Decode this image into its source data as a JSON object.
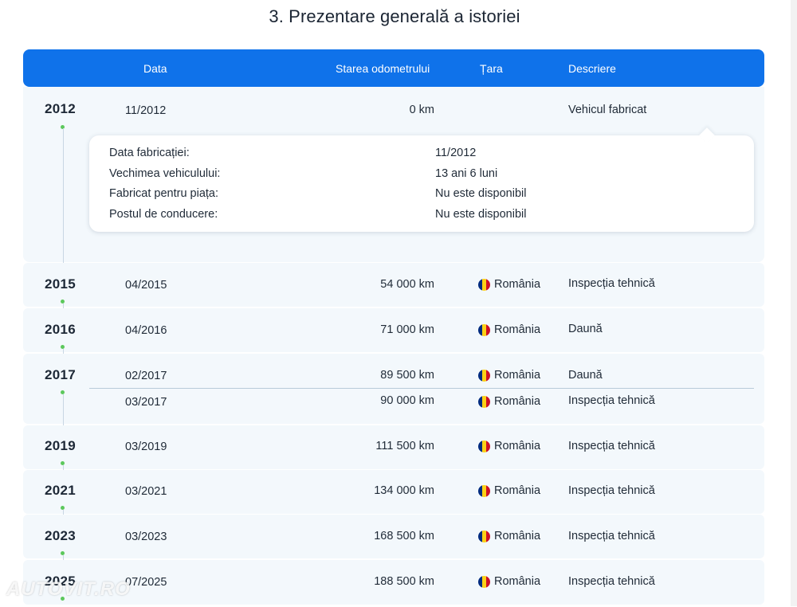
{
  "page": {
    "title": "3. Prezentare generală a istoriei"
  },
  "table": {
    "headers": {
      "date": "Data",
      "odometer": "Starea odometrului",
      "country": "Țara",
      "description": "Descriere"
    },
    "groups": [
      {
        "year": "2012",
        "rows": [
          {
            "date": "11/2012",
            "odometer": "0 km",
            "country": "",
            "description": "Vehicul fabricat"
          }
        ],
        "details": [
          {
            "label": "Data fabricației:",
            "value": "11/2012"
          },
          {
            "label": "Vechimea vehiculului:",
            "value": "13 ani 6 luni"
          },
          {
            "label": "Fabricat pentru piața:",
            "value": "Nu este disponibil"
          },
          {
            "label": "Postul de conducere:",
            "value": "Nu este disponibil"
          }
        ]
      },
      {
        "year": "2015",
        "rows": [
          {
            "date": "04/2015",
            "odometer": "54 000 km",
            "country": "România",
            "description": "Inspecția tehnică"
          }
        ]
      },
      {
        "year": "2016",
        "rows": [
          {
            "date": "04/2016",
            "odometer": "71 000 km",
            "country": "România",
            "description": "Daună"
          }
        ]
      },
      {
        "year": "2017",
        "rows": [
          {
            "date": "02/2017",
            "odometer": "89 500 km",
            "country": "România",
            "description": "Daună"
          },
          {
            "date": "03/2017",
            "odometer": "90 000 km",
            "country": "România",
            "description": "Inspecția tehnică"
          }
        ]
      },
      {
        "year": "2019",
        "rows": [
          {
            "date": "03/2019",
            "odometer": "111 500 km",
            "country": "România",
            "description": "Inspecția tehnică"
          }
        ]
      },
      {
        "year": "2021",
        "rows": [
          {
            "date": "03/2021",
            "odometer": "134 000 km",
            "country": "România",
            "description": "Inspecția tehnică"
          }
        ]
      },
      {
        "year": "2023",
        "rows": [
          {
            "date": "03/2023",
            "odometer": "168 500 km",
            "country": "România",
            "description": "Inspecția tehnică"
          }
        ]
      },
      {
        "year": "2025",
        "rows": [
          {
            "date": "07/2025",
            "odometer": "188 500 km",
            "country": "România",
            "description": "Inspecția tehnică"
          }
        ]
      }
    ]
  },
  "watermark": "AUTOVIT.RO",
  "colors": {
    "header": "#0f72ea",
    "row_bg": "#f3f8fc",
    "dot": "#5cc85c"
  },
  "icons": {
    "country_flag": "romania-flag-icon"
  }
}
